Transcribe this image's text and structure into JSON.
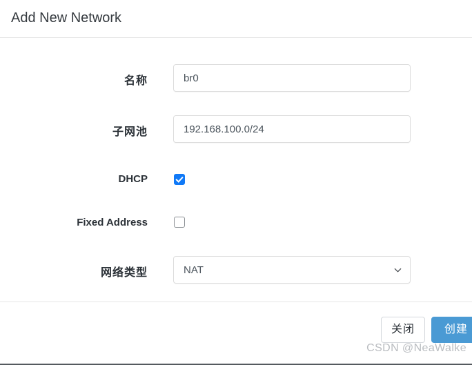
{
  "dialog": {
    "title": "Add New Network"
  },
  "form": {
    "fields": [
      {
        "name": "name",
        "label": "名称",
        "type": "text",
        "value": "br0",
        "placeholder": ""
      },
      {
        "name": "subnet-pool",
        "label": "子网池",
        "type": "text",
        "value": "192.168.100.0/24",
        "placeholder": ""
      },
      {
        "name": "dhcp",
        "label": "DHCP",
        "type": "checkbox",
        "checked": true
      },
      {
        "name": "fixed-address",
        "label": "Fixed Address",
        "type": "checkbox",
        "checked": false
      },
      {
        "name": "network-type",
        "label": "网络类型",
        "type": "select",
        "value": "NAT",
        "options": [
          "NAT"
        ],
        "icon": "chevron-down-icon"
      }
    ]
  },
  "footer": {
    "close_label": "关闭",
    "create_label": "创建"
  },
  "watermark": "CSDN @NeaWalke",
  "colors": {
    "accent_checkbox": "#1079f7",
    "primary_button": "#4a9ad4",
    "border": "#dddddd",
    "text": "#2b3137"
  }
}
